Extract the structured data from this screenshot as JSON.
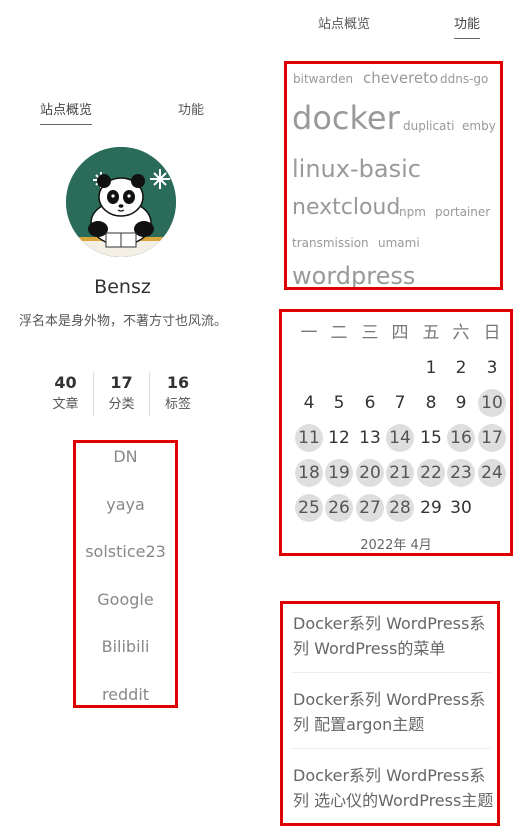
{
  "sidebar_tabs": {
    "overview": "站点概览",
    "functions": "功能"
  },
  "author": {
    "name": "Bensz",
    "description": "浮名本是身外物，不著方寸也风流。"
  },
  "stats": [
    {
      "value": "40",
      "label": "文章"
    },
    {
      "value": "17",
      "label": "分类"
    },
    {
      "value": "16",
      "label": "标签"
    }
  ],
  "links": [
    "DN",
    "yaya",
    "solstice23",
    "Google",
    "Bilibili",
    "reddit"
  ],
  "tags": [
    {
      "name": "bitwarden",
      "size": "small"
    },
    {
      "name": "chevereto",
      "size": "medium"
    },
    {
      "name": "ddns-go",
      "size": "small"
    },
    {
      "name": "docker",
      "size": "xlarge"
    },
    {
      "name": "duplicati",
      "size": "small"
    },
    {
      "name": "emby",
      "size": "small"
    },
    {
      "name": "linux-basic",
      "size": "large"
    },
    {
      "name": "nextcloud",
      "size": "large"
    },
    {
      "name": "npm",
      "size": "small"
    },
    {
      "name": "portainer",
      "size": "small"
    },
    {
      "name": "transmission",
      "size": "small"
    },
    {
      "name": "umami",
      "size": "small"
    },
    {
      "name": "wordpress",
      "size": "large"
    }
  ],
  "calendar": {
    "weekdays": [
      "一",
      "二",
      "三",
      "四",
      "五",
      "六",
      "日"
    ],
    "caption": "2022年 4月",
    "first_weekday_index": 4,
    "days_in_month": 30,
    "days_with_posts": [
      10,
      11,
      14,
      16,
      17,
      18,
      19,
      20,
      21,
      22,
      23,
      24,
      25,
      26,
      27,
      28
    ]
  },
  "recent_posts": [
    "Docker系列 WordPress系列 WordPress的菜单",
    "Docker系列 WordPress系列 配置argon主题",
    "Docker系列 WordPress系列 选心仪的WordPress主题"
  ],
  "colors": {
    "highlight_border": "#e00000",
    "avatar_background": "#2a6b5a",
    "calendar_post_day": "#dedede"
  },
  "icons": {
    "avatar": "panda-avatar"
  }
}
